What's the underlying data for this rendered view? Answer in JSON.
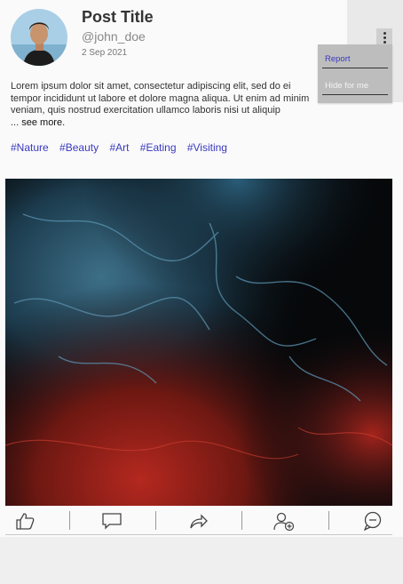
{
  "post": {
    "title": "Post Title",
    "handle": "@john_doe",
    "date": "2 Sep 2021",
    "body_lines": [
      "Lorem ipsum dolor sit amet, consectetur adipiscing elit, sed do ei",
      "tempor incididunt ut labore et dolore magna aliqua. Ut enim ad minim",
      "veniam, quis nostrud exercitation ullamco laboris nisi ut aliquip"
    ],
    "ellipsis": "...",
    "see_more": "see more.",
    "tags": [
      "#Nature",
      "#Beauty",
      "#Art",
      "#Eating",
      "#Visiting"
    ]
  },
  "menu": {
    "items": [
      "Report",
      "Hide for me"
    ],
    "kebab_icon": "kebab-vertical-icon"
  },
  "actions": {
    "icons": [
      "like-icon",
      "comment-icon",
      "share-icon",
      "add-friend-icon",
      "message-icon"
    ]
  },
  "colors": {
    "tag": "#3a39c0",
    "card_bg": "#fafafa",
    "page_bg": "#efefef",
    "dropdown_bg": "#bdbdbd"
  }
}
